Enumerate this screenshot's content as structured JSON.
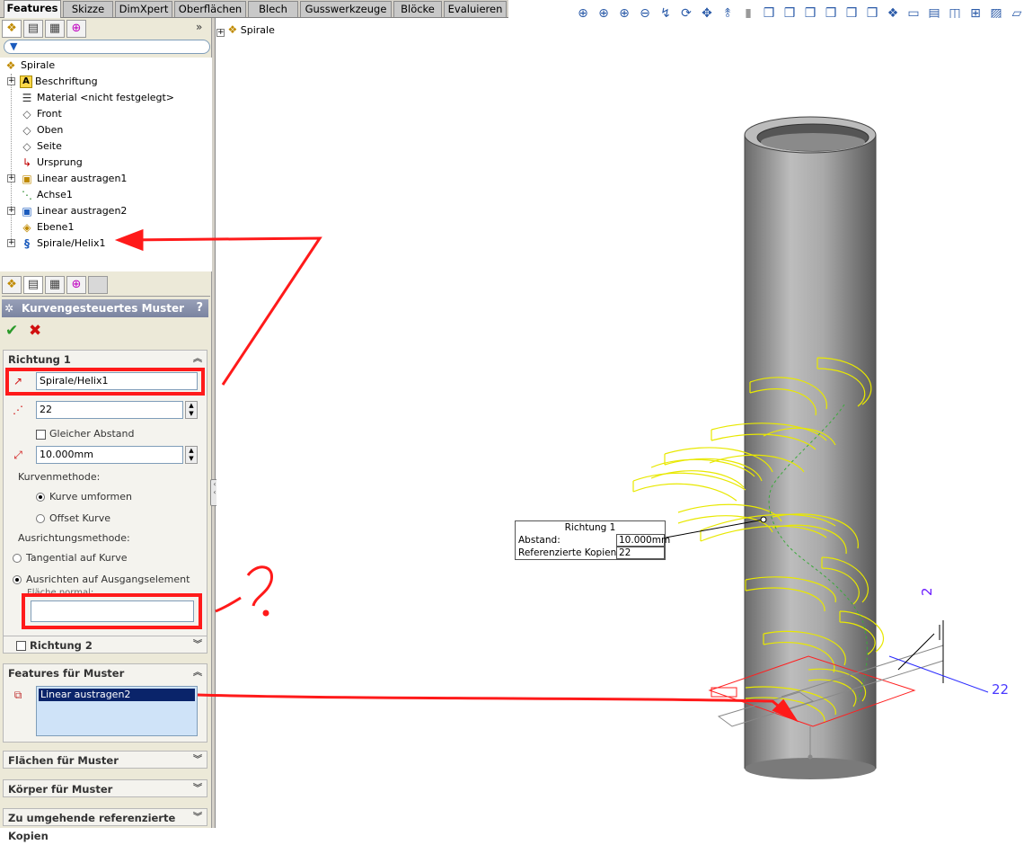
{
  "tabs": [
    "Features",
    "Skizze",
    "DimXpert",
    "Oberflächen",
    "Blech",
    "Gusswerkzeuge",
    "Blöcke",
    "Evaluieren"
  ],
  "tree": {
    "root": "Spirale",
    "items": [
      {
        "label": "Beschriftung",
        "icon": "annotation-icon",
        "expand": true
      },
      {
        "label": "Material <nicht festgelegt>",
        "icon": "material-icon",
        "expand": false
      },
      {
        "label": "Front",
        "icon": "plane-icon",
        "expand": false
      },
      {
        "label": "Oben",
        "icon": "plane-icon",
        "expand": false
      },
      {
        "label": "Seite",
        "icon": "plane-icon",
        "expand": false
      },
      {
        "label": "Ursprung",
        "icon": "origin-icon",
        "expand": false
      },
      {
        "label": "Linear austragen1",
        "icon": "extrude-icon",
        "expand": true
      },
      {
        "label": "Achse1",
        "icon": "axis-icon",
        "expand": false
      },
      {
        "label": "Linear austragen2",
        "icon": "extrude-icon",
        "expand": true
      },
      {
        "label": "Ebene1",
        "icon": "plane-icon",
        "expand": false
      },
      {
        "label": "Spirale/Helix1",
        "icon": "helix-icon",
        "expand": true
      }
    ]
  },
  "pm": {
    "title": "Kurvengesteuertes Muster",
    "help": "?",
    "richtung1": {
      "title": "Richtung 1",
      "curve": "Spirale/Helix1",
      "count": "22",
      "equal_spacing": "Gleicher Abstand",
      "distance": "10.000mm",
      "curve_method_label": "Kurvenmethode:",
      "curve_method_opt1": "Kurve umformen",
      "curve_method_opt2": "Offset Kurve",
      "align_label": "Ausrichtungsmethode:",
      "align_opt1": "Tangential auf Kurve",
      "align_opt2": "Ausrichten auf Ausgangselement",
      "face_normal": "Fläche normal:"
    },
    "richtung2": "Richtung 2",
    "features_title": "Features für Muster",
    "features_item": "Linear austragen2",
    "faces_title": "Flächen für Muster",
    "bodies_title": "Körper für Muster",
    "skip_title": "Zu umgehende referenzierte Kopien"
  },
  "viewport": {
    "tree_root": "Spirale",
    "callout": {
      "title": "Richtung 1",
      "distance_label": "Abstand:",
      "distance_value": "10.000mm",
      "copies_label": "Referenzierte Kopien:",
      "copies_value": "22"
    },
    "dim_vertical": "2",
    "dim_horizontal": "22"
  },
  "annotations": {
    "question": "?"
  },
  "colors": {
    "highlight_red": "#ff1a1a",
    "helix_yellow": "#e8e800",
    "dimension_blue": "#2a2aff",
    "selection_blue": "#0a246a"
  }
}
